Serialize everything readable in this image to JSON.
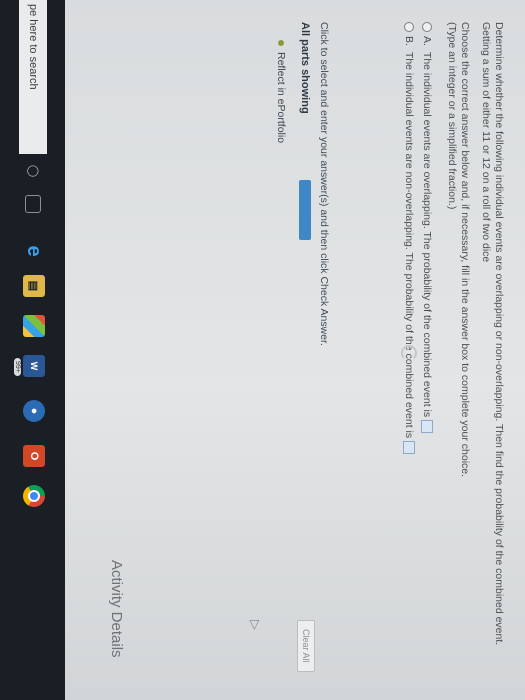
{
  "question": {
    "line1": "Determine whether the following individual events are overlapping or non-overlapping. Then find the probability of the combined event.",
    "line2": "Getting a sum of either 11 or 12 on a roll of two dice",
    "line3": "Choose the correct answer below and, if necessary, fill in the answer box to complete your choice.",
    "line4": "(Type an integer or a simplified fraction.)"
  },
  "options": [
    {
      "letter": "A.",
      "text": "The individual events are overlapping. The probability of the combined event is",
      "selected": false
    },
    {
      "letter": "B.",
      "text": "The individual events are non-overlapping. The probability of the combined event is",
      "selected": false
    }
  ],
  "instruction": "Click to select and enter your answer(s) and then click Check Answer.",
  "parts": {
    "label": "All parts showing",
    "progress_color": "#3f88c5"
  },
  "clear_all_label": "Clear All",
  "reflect_label": "Reflect in ePortfolio",
  "activity_label": "Activity Details",
  "taskbar": {
    "search_placeholder": "pe here to search",
    "word_badge": "99+",
    "icons": [
      "mic-icon",
      "task-view-icon",
      "edge-icon",
      "file-explorer-icon",
      "store-icon",
      "word-icon",
      "app-icon",
      "office-icon",
      "chrome-icon"
    ]
  }
}
